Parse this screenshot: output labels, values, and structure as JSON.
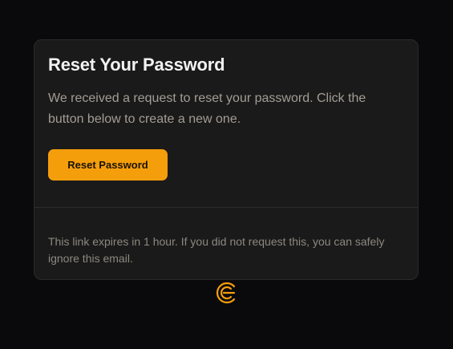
{
  "email": {
    "title": "Reset Your Password",
    "message": "We received a request to reset your password. Click the button below to create a new one.",
    "button_label": "Reset Password",
    "footer_note": "This link expires in 1 hour. If you did not request this, you can safely ignore this email."
  },
  "brand": {
    "logo_icon": "brand-logo-icon",
    "accent_color": "#f59e0b"
  },
  "colors": {
    "page_background": "#0a0a0c",
    "card_background": "#1a1a1a",
    "title_text": "#f2f2f2",
    "body_text": "#a39d95",
    "button_text": "#1a1206"
  }
}
